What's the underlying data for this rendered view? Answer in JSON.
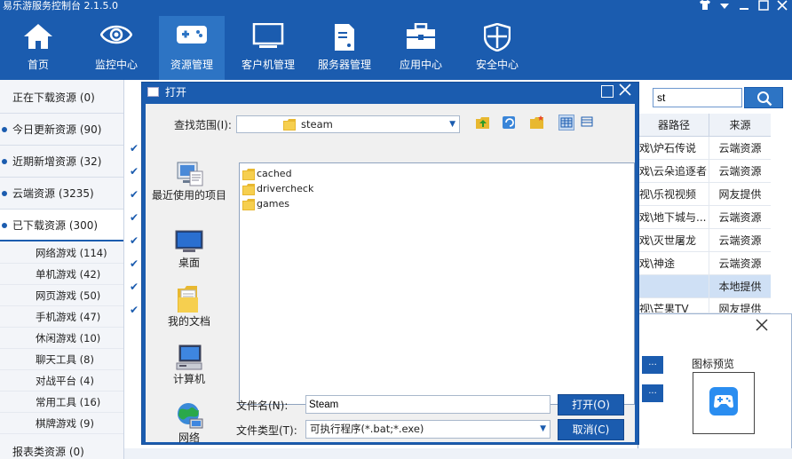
{
  "app": {
    "title": "易乐游服务控制台 2.1.5.0",
    "controls": [
      "shirt-icon",
      "dropdown-icon",
      "minimize-icon",
      "close-icon"
    ]
  },
  "nav": [
    {
      "label": "首页",
      "icon": "home-icon",
      "active": false
    },
    {
      "label": "监控中心",
      "icon": "eye-icon",
      "active": false
    },
    {
      "label": "资源管理",
      "icon": "gamepad-icon",
      "active": true
    },
    {
      "label": "客户机管理",
      "icon": "monitor-icon",
      "active": false
    },
    {
      "label": "服务器管理",
      "icon": "server-icon",
      "active": false
    },
    {
      "label": "应用中心",
      "icon": "toolbox-icon",
      "active": false
    },
    {
      "label": "安全中心",
      "icon": "shield-icon",
      "active": false
    }
  ],
  "sidebar": {
    "categories": [
      {
        "label": "正在下载资源 (0)"
      },
      {
        "label": "今日更新资源 (90)"
      },
      {
        "label": "近期新增资源 (32)"
      },
      {
        "label": "云端资源 (3235)"
      },
      {
        "label": "已下载资源 (300)"
      }
    ],
    "subitems": [
      {
        "label": "网络游戏 (114)"
      },
      {
        "label": "单机游戏 (42)"
      },
      {
        "label": "网页游戏 (50)"
      },
      {
        "label": "手机游戏 (47)"
      },
      {
        "label": "休闲游戏 (10)"
      },
      {
        "label": "聊天工具 (8)"
      },
      {
        "label": "对战平台 (4)"
      },
      {
        "label": "常用工具 (16)"
      },
      {
        "label": "棋牌游戏 (9)"
      }
    ],
    "partial_bottom": "报表类资源 (0)"
  },
  "search": {
    "value": "st"
  },
  "table": {
    "headers": {
      "path": "器路径",
      "source": "来源"
    },
    "rows": [
      {
        "path": "戏\\炉石传说",
        "source": "云端资源"
      },
      {
        "path": "戏\\云朵追逐者",
        "source": "云端资源"
      },
      {
        "path": "视\\乐视视频",
        "source": "网友提供"
      },
      {
        "path": "戏\\地下城与...",
        "source": "云端资源"
      },
      {
        "path": "戏\\灭世屠龙",
        "source": "云端资源"
      },
      {
        "path": "戏\\神途",
        "source": "云端资源"
      },
      {
        "path": "",
        "source": "本地提供"
      },
      {
        "path": "视\\芒果TV",
        "source": "网友提供"
      }
    ]
  },
  "panel": {
    "icon_preview_label": "图标预览",
    "dots": "..."
  },
  "dialog": {
    "title": "打开",
    "lookin_label": "查找范围(I):",
    "lookin_value": "steam",
    "places": [
      {
        "label": "最近使用的项目",
        "icon": "recent-icon"
      },
      {
        "label": "桌面",
        "icon": "desktop-icon"
      },
      {
        "label": "我的文档",
        "icon": "documents-icon"
      },
      {
        "label": "计算机",
        "icon": "computer-icon"
      },
      {
        "label": "网络",
        "icon": "network-icon"
      }
    ],
    "files": [
      {
        "name": "cached"
      },
      {
        "name": "drivercheck"
      },
      {
        "name": "games"
      }
    ],
    "filename_label": "文件名(N):",
    "filename_value": "Steam",
    "filetype_label": "文件类型(T):",
    "filetype_value": "可执行程序(*.bat;*.exe)",
    "open_button": "打开(O)",
    "cancel_button": "取消(C)"
  },
  "colors": {
    "brand": "#1b5caf",
    "active_nav": "#2d74c4"
  }
}
